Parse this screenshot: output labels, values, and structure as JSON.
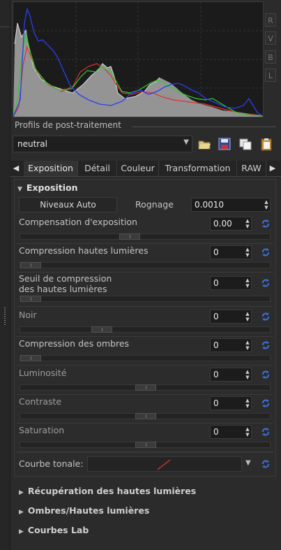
{
  "histogram": {
    "channels": [
      "R",
      "V",
      "B",
      "L"
    ],
    "colors": {
      "red": "#e03030",
      "green": "#2ecc2e",
      "blue": "#2a3ff0",
      "luma": "#b8b8b8"
    }
  },
  "profiles": {
    "title": "Profils de post-traitement",
    "selected": "neutral",
    "buttons": [
      "open-folder-icon",
      "save-icon",
      "copy-icon",
      "paste-icon"
    ]
  },
  "tabs": [
    "Exposition",
    "Détail",
    "Couleur",
    "Transformation",
    "RAW"
  ],
  "exposition": {
    "header": "Exposition",
    "auto_levels": "Niveaux Auto",
    "clip_label": "Rognage",
    "clip_value": "0.0010",
    "sliders": [
      {
        "label": "Compensation d'exposition",
        "value": "0.00",
        "level": 0.43
      },
      {
        "label": "Compression hautes lumières",
        "value": "0",
        "level": 0.0
      },
      {
        "label": "Seuil de compression\ndes hautes lumières",
        "value": "0",
        "level": 0.0
      },
      {
        "label": "Noir",
        "value": "0",
        "level": 0.31
      },
      {
        "label": "Compression des ombres",
        "value": "0",
        "level": 0.0
      },
      {
        "label": "Luminosité",
        "value": "0",
        "level": 0.5
      },
      {
        "label": "Contraste",
        "value": "0",
        "level": 0.5
      },
      {
        "label": "Saturation",
        "value": "0",
        "level": 0.5
      }
    ],
    "curve_label": "Courbe tonale:"
  },
  "sections": [
    "Récupération des hautes lumières",
    "Ombres/Hautes lumières",
    "Courbes Lab"
  ],
  "accent": "#3d6fd8"
}
